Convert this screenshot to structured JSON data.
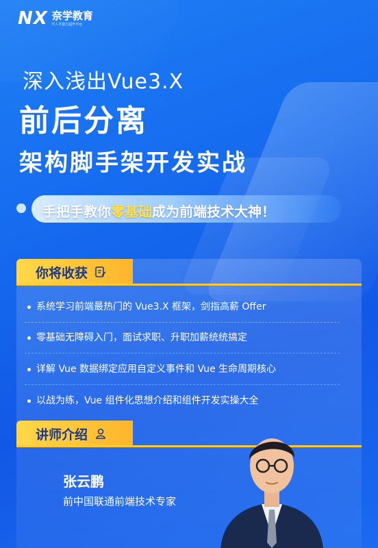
{
  "brand": {
    "mark": "NX",
    "name": "奈学教育",
    "tagline": "IT人才能力提升平台"
  },
  "hero": {
    "line1": "深入浅出Vue3.X",
    "line2": "前后分离",
    "line3": "架构脚手架开发实战"
  },
  "slogan": {
    "prefix": "手把手教你",
    "highlight": "零基础",
    "suffix": "成为前端技术大神！"
  },
  "benefits": {
    "heading": "你将收获",
    "items": [
      "系统学习前端最热门的 Vue3.X 框架，剑指高薪 Offer",
      "零基础无障碍入门，面试求职、升职加薪统统搞定",
      "详解 Vue 数据绑定应用自定义事件和 Vue 生命周期核心",
      "以战为练，Vue 组件化思想介绍和组件开发实操大全"
    ]
  },
  "instructor": {
    "heading": "讲师介绍",
    "name": "张云鹏",
    "title": "前中国联通前端技术专家"
  },
  "colors": {
    "background": "#1569ee",
    "accent": "#ffd84a",
    "highlight": "#ffe14d"
  },
  "icons": [
    "document-edit-icon",
    "person-icon"
  ]
}
